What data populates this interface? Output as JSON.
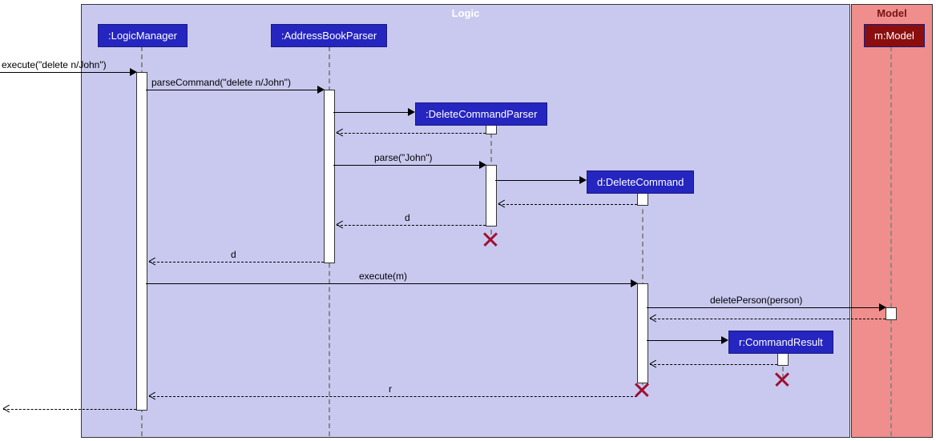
{
  "frames": {
    "logic": {
      "label": "Logic"
    },
    "model": {
      "label": "Model"
    }
  },
  "participants": {
    "logicManager": ":LogicManager",
    "addressBookParser": ":AddressBookParser",
    "deleteCommandParser": ":DeleteCommandParser",
    "deleteCommand": "d:DeleteCommand",
    "commandResult": "r:CommandResult",
    "model": "m:Model"
  },
  "messages": {
    "execute1": "execute(\"delete n/John\")",
    "parseCommand": "parseCommand(\"delete n/John\")",
    "parseJohn": "parse(\"John\")",
    "returnD1": "d",
    "returnD2": "d",
    "executeM": "execute(m)",
    "deletePerson": "deletePerson(person)",
    "returnR": "r"
  },
  "chart_data": {
    "type": "sequence-diagram",
    "frames": [
      {
        "name": "Logic",
        "participants": [
          "LogicManager",
          "AddressBookParser",
          "DeleteCommandParser",
          "DeleteCommand",
          "CommandResult"
        ]
      },
      {
        "name": "Model",
        "participants": [
          "Model"
        ]
      }
    ],
    "participants": [
      {
        "id": "LogicManager",
        "label": ":LogicManager"
      },
      {
        "id": "AddressBookParser",
        "label": ":AddressBookParser"
      },
      {
        "id": "DeleteCommandParser",
        "label": ":DeleteCommandParser",
        "created_by_message": 3,
        "destroyed_after_message": 8
      },
      {
        "id": "DeleteCommand",
        "label": "d:DeleteCommand",
        "created_by_message": 6,
        "destroyed_after_message": 14
      },
      {
        "id": "CommandResult",
        "label": "r:CommandResult",
        "created_by_message": 13,
        "destroyed_after_message": 13
      },
      {
        "id": "Model",
        "label": "m:Model"
      }
    ],
    "messages": [
      {
        "seq": 1,
        "from": "external",
        "to": "LogicManager",
        "label": "execute(\"delete n/John\")",
        "type": "call"
      },
      {
        "seq": 2,
        "from": "LogicManager",
        "to": "AddressBookParser",
        "label": "parseCommand(\"delete n/John\")",
        "type": "call"
      },
      {
        "seq": 3,
        "from": "AddressBookParser",
        "to": "DeleteCommandParser",
        "label": "",
        "type": "create"
      },
      {
        "seq": 4,
        "from": "DeleteCommandParser",
        "to": "AddressBookParser",
        "label": "",
        "type": "return"
      },
      {
        "seq": 5,
        "from": "AddressBookParser",
        "to": "DeleteCommandParser",
        "label": "parse(\"John\")",
        "type": "call"
      },
      {
        "seq": 6,
        "from": "DeleteCommandParser",
        "to": "DeleteCommand",
        "label": "",
        "type": "create"
      },
      {
        "seq": 7,
        "from": "DeleteCommand",
        "to": "DeleteCommandParser",
        "label": "",
        "type": "return"
      },
      {
        "seq": 8,
        "from": "DeleteCommandParser",
        "to": "AddressBookParser",
        "label": "d",
        "type": "return"
      },
      {
        "seq": 9,
        "from": "AddressBookParser",
        "to": "LogicManager",
        "label": "d",
        "type": "return"
      },
      {
        "seq": 10,
        "from": "LogicManager",
        "to": "DeleteCommand",
        "label": "execute(m)",
        "type": "call"
      },
      {
        "seq": 11,
        "from": "DeleteCommand",
        "to": "Model",
        "label": "deletePerson(person)",
        "type": "call"
      },
      {
        "seq": 12,
        "from": "Model",
        "to": "DeleteCommand",
        "label": "",
        "type": "return"
      },
      {
        "seq": 13,
        "from": "DeleteCommand",
        "to": "CommandResult",
        "label": "",
        "type": "create"
      },
      {
        "seq": 14,
        "from": "CommandResult",
        "to": "DeleteCommand",
        "label": "",
        "type": "return"
      },
      {
        "seq": 15,
        "from": "DeleteCommand",
        "to": "LogicManager",
        "label": "r",
        "type": "return"
      },
      {
        "seq": 16,
        "from": "LogicManager",
        "to": "external",
        "label": "",
        "type": "return"
      }
    ]
  }
}
